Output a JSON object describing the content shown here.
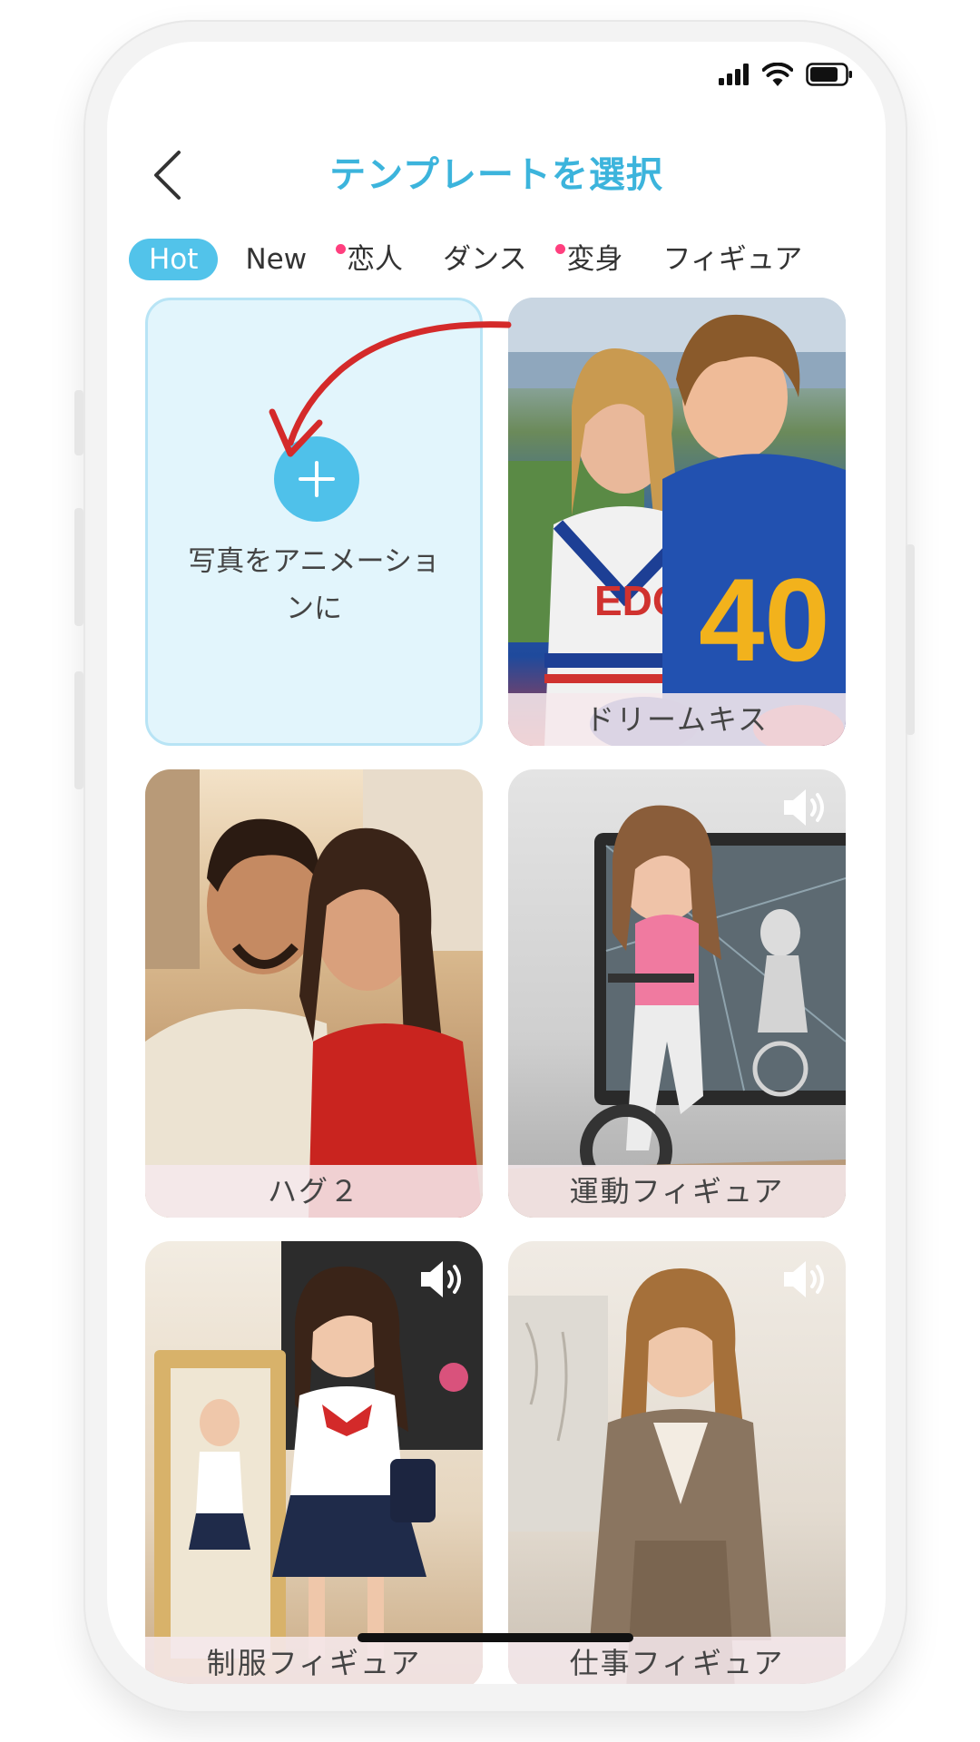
{
  "status_bar": {
    "signal_icon": "signal-icon",
    "wifi_icon": "wifi-icon",
    "battery_icon": "battery-icon"
  },
  "header": {
    "back_icon": "chevron-left-icon",
    "title": "テンプレートを選択"
  },
  "tabs": [
    {
      "label": "Hot",
      "active": true,
      "dot": false
    },
    {
      "label": "New",
      "active": false,
      "dot": false
    },
    {
      "label": "恋人",
      "active": false,
      "dot": true
    },
    {
      "label": "ダンス",
      "active": false,
      "dot": false
    },
    {
      "label": "変身",
      "active": false,
      "dot": true
    },
    {
      "label": "フィギュア",
      "active": false,
      "dot": false
    }
  ],
  "upload_card": {
    "icon": "plus-icon",
    "label": "写真をアニメーションに"
  },
  "templates": [
    {
      "caption": "ドリームキス",
      "sound": false
    },
    {
      "caption": "ハグ２",
      "sound": false
    },
    {
      "caption": "運動フィギュア",
      "sound": true
    },
    {
      "caption": "制服フィギュア",
      "sound": true
    },
    {
      "caption": "仕事フィギュア",
      "sound": true
    }
  ],
  "colors": {
    "accent": "#3cb4dc",
    "tab_active_bg": "#52c3ea",
    "tab_dot": "#ff3f7e",
    "upload_bg": "#e2f5fc",
    "annotation_arrow": "#d42a2a"
  }
}
